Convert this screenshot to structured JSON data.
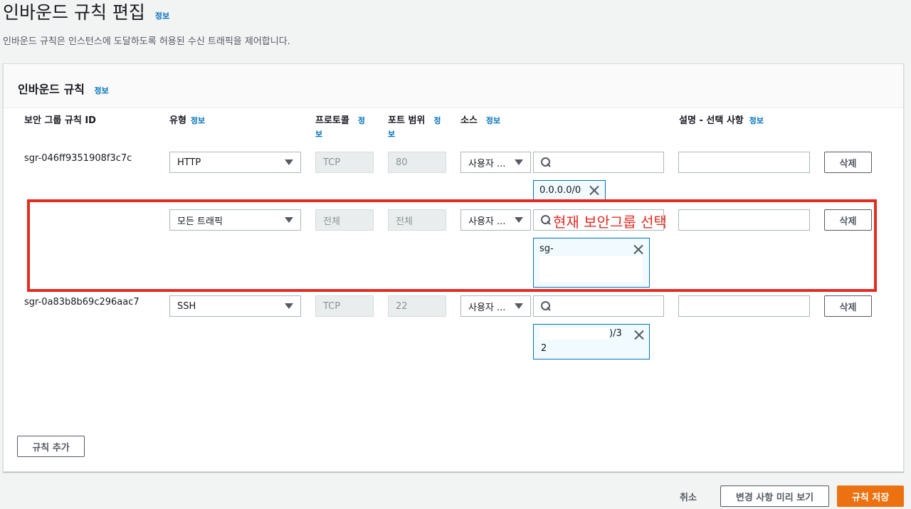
{
  "page": {
    "title": "인바운드 규칙 편집",
    "info": "정보",
    "description": "인바운드 규칙은 인스턴스에 도달하도록 허용된 수신 트래픽을 제어합니다."
  },
  "panel": {
    "title": "인바운드 규칙",
    "info": "정보"
  },
  "columns": {
    "rule_id": "보안 그룹 규칙 ID",
    "type": "유형",
    "protocol": "프로토콜",
    "port_range": "포트 범위",
    "source": "소스",
    "description": "설명 - 선택 사항",
    "info": "정보",
    "info_top": "정",
    "info_bottom": "보"
  },
  "rules": [
    {
      "id": "sgr-046ff9351908f3c7c",
      "type": "HTTP",
      "protocol": "TCP",
      "port": "80",
      "source_type": "사용자 ...",
      "token": "0.0.0.0/0",
      "delete": "삭제"
    },
    {
      "id": "",
      "type": "모든 트래픽",
      "protocol": "전체",
      "port": "전체",
      "source_type": "사용자 ...",
      "token": "sg-",
      "delete": "삭제"
    },
    {
      "id": "sgr-0a83b8b69c296aac7",
      "type": "SSH",
      "protocol": "TCP",
      "port": "22",
      "source_type": "사용자 ...",
      "token_line1": ")/3",
      "token_line2": "2",
      "delete": "삭제"
    }
  ],
  "annotation": {
    "text": "현재 보안그룹 선택",
    "color": "#e32b22"
  },
  "buttons": {
    "add_rule": "규칙 추가",
    "cancel": "취소",
    "preview": "변경 사항 미리 보기",
    "save": "규칙 저장"
  },
  "colors": {
    "primary": "#ec7211",
    "link": "#0073bb",
    "token_border": "#0073bb"
  }
}
